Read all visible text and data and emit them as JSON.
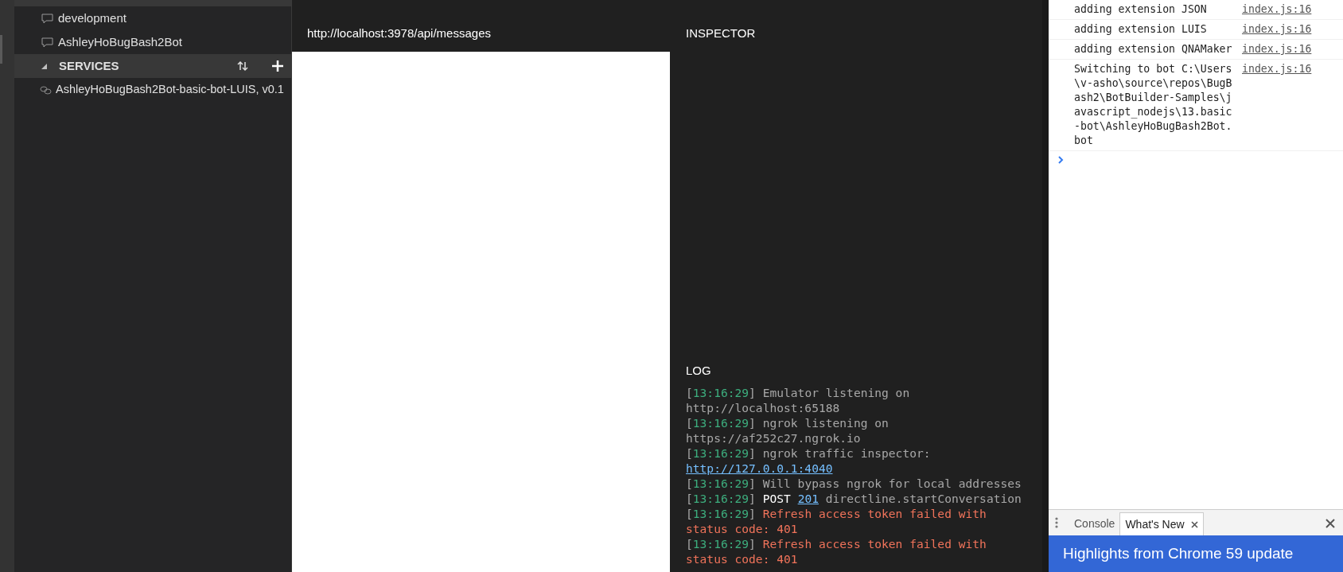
{
  "sidebar": {
    "bots": [
      {
        "label": "development",
        "selected": false
      },
      {
        "label": "AshleyHoBugBash2Bot",
        "selected": false
      }
    ],
    "services_section": {
      "title": "SERVICES",
      "expanded": true,
      "items": [
        {
          "label": "AshleyHoBugBash2Bot-basic-bot-LUIS, v0.1"
        }
      ]
    }
  },
  "chat": {
    "endpoint": "http://localhost:3978/api/messages"
  },
  "inspector": {
    "title": "INSPECTOR"
  },
  "log": {
    "title": "LOG",
    "entries": [
      {
        "time": "[13:16:29]",
        "segments": [
          {
            "kind": "text",
            "text": "Emulator listening on http://localhost:65188"
          }
        ]
      },
      {
        "time": "[13:16:29]",
        "segments": [
          {
            "kind": "text",
            "text": "ngrok listening on https://af252c27.ngrok.io"
          }
        ]
      },
      {
        "time": "[13:16:29]",
        "segments": [
          {
            "kind": "text",
            "text": "ngrok traffic inspector:"
          },
          {
            "kind": "link",
            "text": "http://127.0.0.1:4040"
          }
        ]
      },
      {
        "time": "[13:16:29]",
        "segments": [
          {
            "kind": "text",
            "text": "Will bypass ngrok for local addresses"
          }
        ]
      },
      {
        "time": "[13:16:29]",
        "segments": [
          {
            "kind": "method",
            "text": "POST"
          },
          {
            "kind": "link",
            "text": "201"
          },
          {
            "kind": "text",
            "text": "directline.startConversation"
          }
        ]
      },
      {
        "time": "[13:16:29]",
        "segments": [
          {
            "kind": "error",
            "text": "Refresh access token failed with status code: 401"
          }
        ]
      },
      {
        "time": "[13:16:29]",
        "segments": [
          {
            "kind": "error",
            "text": "Refresh access token failed with status code: 401"
          }
        ]
      }
    ]
  },
  "devtools": {
    "messages": [
      {
        "text": "adding extension JSON",
        "source": "index.js:16"
      },
      {
        "text": "adding extension LUIS",
        "source": "index.js:16"
      },
      {
        "text": "adding extension QNAMaker",
        "source": "index.js:16"
      },
      {
        "text": "Switching to bot C:\\Users\\v-asho\\source\\repos\\BugBash2\\BotBuilder-Samples\\javascript_nodejs\\13.basic-bot\\AshleyHoBugBash2Bot.bot",
        "source": "index.js:16"
      }
    ],
    "drawer_tabs": [
      {
        "label": "Console",
        "selected": false,
        "closable": false
      },
      {
        "label": "What's New",
        "selected": true,
        "closable": true
      }
    ],
    "banner": "Highlights from Chrome 59 update"
  }
}
